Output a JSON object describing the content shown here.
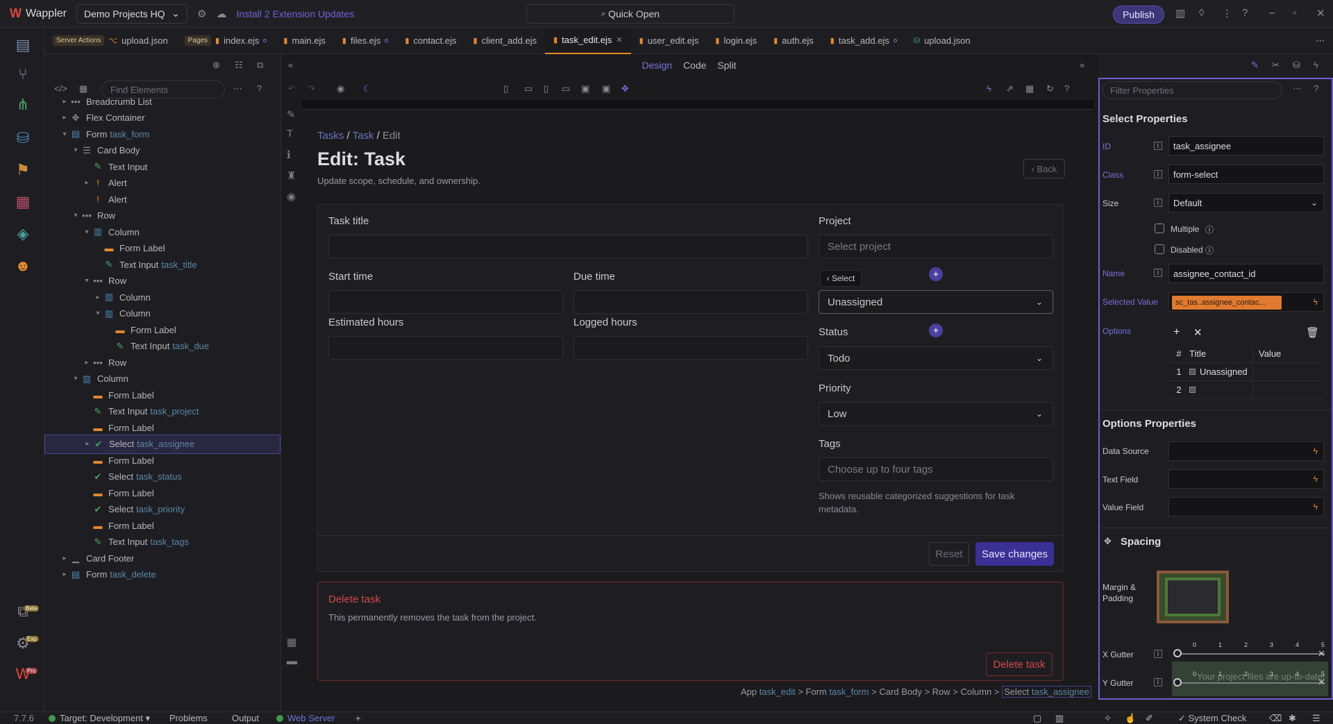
{
  "app": {
    "name": "Wappler",
    "project": "Demo Projects HQ",
    "updates_link": "Install 2 Extension Updates",
    "quick_open": "Quick Open",
    "publish": "Publish"
  },
  "rail": {
    "badges": {
      "beta": "Beta",
      "exp": "Exp",
      "pro": "Pro"
    }
  },
  "tabs": [
    {
      "label": "upload.json",
      "prefix": "Server Actions"
    },
    {
      "label": "index.ejs",
      "prefix": "Pages"
    },
    {
      "label": "main.ejs"
    },
    {
      "label": "files.ejs"
    },
    {
      "label": "contact.ejs"
    },
    {
      "label": "client_add.ejs"
    },
    {
      "label": "task_edit.ejs",
      "active": true
    },
    {
      "label": "user_edit.ejs"
    },
    {
      "label": "login.ejs"
    },
    {
      "label": "auth.ejs"
    },
    {
      "label": "task_add.ejs"
    },
    {
      "label": "upload.json"
    }
  ],
  "structure": {
    "find_placeholder": "Find Elements",
    "tree": [
      {
        "label": "Breadcrumb List",
        "id": "",
        "icon": "•••"
      },
      {
        "label": "Flex Container",
        "id": "",
        "icon": "✥"
      },
      {
        "label": "Form",
        "id": "task_form",
        "icon": "▤"
      },
      {
        "label": "Card Body",
        "id": "",
        "icon": "☰"
      },
      {
        "label": "Text Input",
        "id": "",
        "icon": "✎"
      },
      {
        "label": "Alert",
        "id": "",
        "icon": "!"
      },
      {
        "label": "Alert",
        "id": "",
        "icon": "!"
      },
      {
        "label": "Row",
        "id": "",
        "icon": "•••"
      },
      {
        "label": "Column",
        "id": "",
        "icon": "▥"
      },
      {
        "label": "Form Label",
        "id": "",
        "icon": "▬"
      },
      {
        "label": "Text Input",
        "id": "task_title",
        "icon": "✎"
      },
      {
        "label": "Row",
        "id": "",
        "icon": "•••"
      },
      {
        "label": "Column",
        "id": "",
        "icon": "▥"
      },
      {
        "label": "Column",
        "id": "",
        "icon": "▥"
      },
      {
        "label": "Form Label",
        "id": "",
        "icon": "▬"
      },
      {
        "label": "Text Input",
        "id": "task_due",
        "icon": "✎"
      },
      {
        "label": "Row",
        "id": "",
        "icon": "•••"
      },
      {
        "label": "Column",
        "id": "",
        "icon": "▥"
      },
      {
        "label": "Form Label",
        "id": "",
        "icon": "▬"
      },
      {
        "label": "Text Input",
        "id": "task_project",
        "icon": "✎"
      },
      {
        "label": "Form Label",
        "id": "",
        "icon": "▬"
      },
      {
        "label": "Select",
        "id": "task_assignee",
        "icon": "✔"
      },
      {
        "label": "Form Label",
        "id": "",
        "icon": "▬"
      },
      {
        "label": "Select",
        "id": "task_status",
        "icon": "✔"
      },
      {
        "label": "Form Label",
        "id": "",
        "icon": "▬"
      },
      {
        "label": "Select",
        "id": "task_priority",
        "icon": "✔"
      },
      {
        "label": "Form Label",
        "id": "",
        "icon": "▬"
      },
      {
        "label": "Text Input",
        "id": "task_tags",
        "icon": "✎"
      },
      {
        "label": "Card Footer",
        "id": "",
        "icon": "▁"
      },
      {
        "label": "Form",
        "id": "task_delete",
        "icon": "▤"
      }
    ]
  },
  "canvas": {
    "modes": [
      "Design",
      "Code",
      "Split"
    ],
    "breadcrumb": [
      "Tasks",
      "/",
      "Task",
      "/",
      "Edit"
    ],
    "title": "Edit: Task",
    "subtitle": "Update scope, schedule, and ownership.",
    "back": "Back",
    "fields": {
      "task_title": "Task title",
      "start_time": "Start time",
      "due_time": "Due time",
      "estimated_hours": "Estimated hours",
      "logged_hours": "Logged hours",
      "project": "Project",
      "project_placeholder": "Select project",
      "assignee_value": "Unassigned",
      "status": "Status",
      "status_value": "Todo",
      "priority": "Priority",
      "priority_value": "Low",
      "tags": "Tags",
      "tags_placeholder": "Choose up to four tags",
      "tags_help": "Shows reusable categorized suggestions for task metadata."
    },
    "select_tip": "Select",
    "reset": "Reset",
    "save": "Save changes",
    "delete_title": "Delete task",
    "delete_text": "This permanently removes the task from the project.",
    "delete_button": "Delete task",
    "path": {
      "p1": "App",
      "p1id": "task_edit",
      "p2": "> Form",
      "p2id": "task_form",
      "p3": "> Card Body > Row > Column >",
      "p4": "Select",
      "p4id": "task_assignee"
    }
  },
  "props": {
    "filter_placeholder": "Filter Properties",
    "title": "Select Properties",
    "id_label": "ID",
    "id_value": "task_assignee",
    "class_label": "Class",
    "class_value": "form-select",
    "size_label": "Size",
    "size_value": "Default",
    "multiple": "Multiple",
    "disabled": "Disabled",
    "name_label": "Name",
    "name_value": "assignee_contact_id",
    "selected_label": "Selected Value",
    "selected_value": "sc_tas..assignee_contac...",
    "options_label": "Options",
    "options_head": {
      "num": "#",
      "title": "Title",
      "value": "Value"
    },
    "options": [
      {
        "n": "1",
        "title": "Unassigned",
        "value": ""
      },
      {
        "n": "2",
        "title": "",
        "value": ""
      }
    ],
    "options_props_title": "Options Properties",
    "data_source": "Data Source",
    "text_field": "Text Field",
    "value_field": "Value Field",
    "spacing_title": "Spacing",
    "margin_padding": "Margin & Padding",
    "x_gutter": "X Gutter",
    "y_gutter": "Y Gutter",
    "gutter_ticks": [
      "0",
      "1",
      "2",
      "3",
      "4",
      "5"
    ],
    "toast": "Your project files are up-to-date!"
  },
  "status": {
    "version": "7.7.6",
    "target": "Target: Development",
    "problems": "Problems",
    "output": "Output",
    "web_server": "Web Server",
    "system_check": "System Check"
  },
  "colors": {
    "accent": "#6c5fd0",
    "danger": "#d04848",
    "tab_active": "#e58a2f"
  }
}
